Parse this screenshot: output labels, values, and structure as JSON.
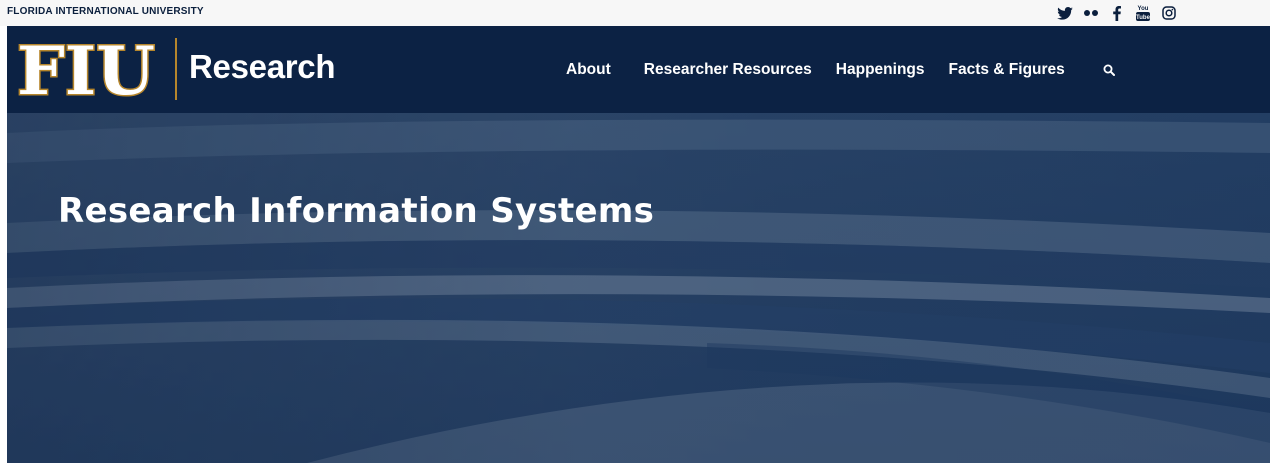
{
  "topbar": {
    "university_name": "FLORIDA INTERNATIONAL UNIVERSITY",
    "social_icons": [
      "twitter-icon",
      "flickr-icon",
      "facebook-icon",
      "youtube-icon",
      "instagram-icon"
    ],
    "youtube_text": "You Tube"
  },
  "header": {
    "logo_mark": "FIU",
    "logo_text": "Research",
    "nav": {
      "about": "About",
      "researcher_resources": "Researcher Resources",
      "happenings": "Happenings",
      "facts_figures": "Facts & Figures"
    },
    "search_icon": "search-icon"
  },
  "hero": {
    "title": "Research Information Systems"
  },
  "colors": {
    "navy": "#0c2244",
    "gold": "#b6862c",
    "topbar_bg": "#f7f7f7",
    "white": "#ffffff"
  }
}
